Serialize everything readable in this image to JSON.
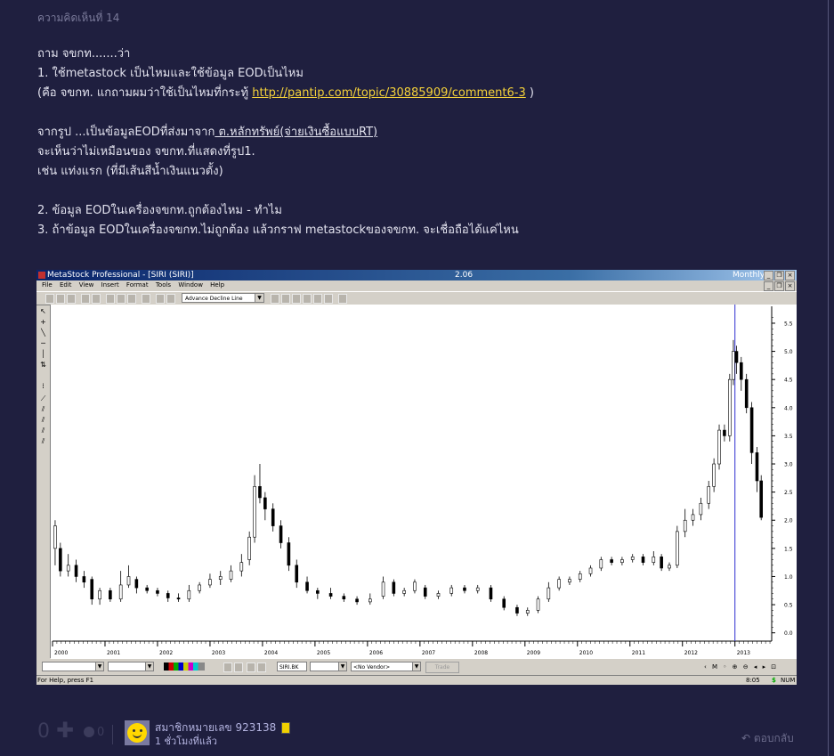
{
  "comment": {
    "number_label": "ความคิดเห็นที่ 14",
    "lines": [
      "ถาม จขกท.......ว่า",
      "1. ใช้metastock เป็นไหมและใช้ข้อมูล EODเป็นไหม",
      "(คือ จขกท. แกถามผมว่าใช้เป็นไหมที่กระทู้ ",
      "http://pantip.com/topic/30885909/comment6-3",
      " )",
      "จากรูป ...เป็นข้อมูลEODที่ส่งมาจาก",
      " ต.หลักทรัพย์(จ่ายเงินซื้อแบบRT)",
      "จะเห็นว่าไม่เหมือนของ จขกท.ที่แสดงที่รูป1.",
      "เช่น แท่งแรก (ที่มีเส้นสีน้ำเงินแนวตั้ง)",
      "2. ข้อมูล EODในเครื่องจขกท.ถูกต้องไหม - ทำไม",
      "3. ถ้าข้อมูล EODในเครื่องจขกท.ไม่ถูกต้อง แล้วกราฟ metastockของจขกท. จะเชื่อถือได้แค่ไหน"
    ]
  },
  "screenshot": {
    "title": "MetaStock Professional - [SIRI (SIRI)]",
    "version": "2.06",
    "period": "Monthly",
    "menu": [
      "File",
      "Edit",
      "View",
      "Insert",
      "Format",
      "Tools",
      "Window",
      "Help"
    ],
    "indicator_select": "Advance Decline Line",
    "symbol_box": "SIRI.BK",
    "vendor_select": "<No Vendor>",
    "trade_label": "Trade",
    "status_help": "For Help, press F1",
    "status_time": "8:05",
    "status_dollar": "$",
    "status_num": "NUM"
  },
  "chart_data": {
    "type": "candlestick",
    "title": "",
    "x_tick_labels": [
      "2000",
      "2001",
      "2002",
      "2003",
      "2004",
      "2005",
      "2006",
      "2007",
      "2008",
      "2009",
      "2010",
      "2011",
      "2012",
      "2013"
    ],
    "y_tick_labels": [
      "0.0",
      "0.5",
      "1.0",
      "1.5",
      "2.0",
      "2.5",
      "3.0",
      "3.5",
      "4.0",
      "4.5",
      "5.0",
      "5.5"
    ],
    "ylim": [
      -0.1,
      5.8
    ],
    "xlim": [
      2000.0,
      2013.7
    ],
    "grid": false,
    "line_color": "#000000",
    "marker_line": {
      "x": 2013.0,
      "color": "#3030d0"
    },
    "series": [
      {
        "values": [
          {
            "x": 2000.05,
            "o": 1.5,
            "c": 1.9,
            "h": 2.0,
            "l": 1.2
          },
          {
            "x": 2000.15,
            "o": 1.5,
            "c": 1.1,
            "h": 1.6,
            "l": 1.0
          },
          {
            "x": 2000.3,
            "o": 1.1,
            "c": 1.2,
            "h": 1.4,
            "l": 1.0
          },
          {
            "x": 2000.45,
            "o": 1.2,
            "c": 1.0,
            "h": 1.3,
            "l": 0.9
          },
          {
            "x": 2000.6,
            "o": 1.0,
            "c": 0.9,
            "h": 1.1,
            "l": 0.8
          },
          {
            "x": 2000.75,
            "o": 0.95,
            "c": 0.6,
            "h": 1.0,
            "l": 0.5
          },
          {
            "x": 2000.9,
            "o": 0.6,
            "c": 0.75,
            "h": 0.8,
            "l": 0.5
          },
          {
            "x": 2001.1,
            "o": 0.75,
            "c": 0.6,
            "h": 0.8,
            "l": 0.55
          },
          {
            "x": 2001.3,
            "o": 0.6,
            "c": 0.85,
            "h": 1.1,
            "l": 0.55
          },
          {
            "x": 2001.45,
            "o": 0.85,
            "c": 1.0,
            "h": 1.2,
            "l": 0.8
          },
          {
            "x": 2001.6,
            "o": 0.95,
            "c": 0.8,
            "h": 1.0,
            "l": 0.7
          },
          {
            "x": 2001.8,
            "o": 0.8,
            "c": 0.75,
            "h": 0.85,
            "l": 0.7
          },
          {
            "x": 2002.0,
            "o": 0.75,
            "c": 0.7,
            "h": 0.8,
            "l": 0.65
          },
          {
            "x": 2002.2,
            "o": 0.7,
            "c": 0.62,
            "h": 0.75,
            "l": 0.55
          },
          {
            "x": 2002.4,
            "o": 0.62,
            "c": 0.6,
            "h": 0.7,
            "l": 0.55
          },
          {
            "x": 2002.6,
            "o": 0.6,
            "c": 0.75,
            "h": 0.85,
            "l": 0.55
          },
          {
            "x": 2002.8,
            "o": 0.75,
            "c": 0.85,
            "h": 0.9,
            "l": 0.7
          },
          {
            "x": 2003.0,
            "o": 0.85,
            "c": 0.95,
            "h": 1.05,
            "l": 0.8
          },
          {
            "x": 2003.2,
            "o": 0.95,
            "c": 1.0,
            "h": 1.1,
            "l": 0.85
          },
          {
            "x": 2003.4,
            "o": 0.95,
            "c": 1.1,
            "h": 1.2,
            "l": 0.9
          },
          {
            "x": 2003.6,
            "o": 1.1,
            "c": 1.25,
            "h": 1.4,
            "l": 1.0
          },
          {
            "x": 2003.75,
            "o": 1.3,
            "c": 1.7,
            "h": 1.8,
            "l": 1.2
          },
          {
            "x": 2003.85,
            "o": 1.7,
            "c": 2.6,
            "h": 2.8,
            "l": 1.6
          },
          {
            "x": 2003.95,
            "o": 2.6,
            "c": 2.4,
            "h": 3.0,
            "l": 2.3
          },
          {
            "x": 2004.05,
            "o": 2.4,
            "c": 2.2,
            "h": 2.5,
            "l": 2.0
          },
          {
            "x": 2004.2,
            "o": 2.2,
            "c": 1.9,
            "h": 2.3,
            "l": 1.8
          },
          {
            "x": 2004.35,
            "o": 1.9,
            "c": 1.6,
            "h": 2.0,
            "l": 1.5
          },
          {
            "x": 2004.5,
            "o": 1.6,
            "c": 1.2,
            "h": 1.7,
            "l": 1.1
          },
          {
            "x": 2004.65,
            "o": 1.2,
            "c": 0.9,
            "h": 1.3,
            "l": 0.8
          },
          {
            "x": 2004.85,
            "o": 0.9,
            "c": 0.75,
            "h": 1.0,
            "l": 0.7
          },
          {
            "x": 2005.05,
            "o": 0.75,
            "c": 0.7,
            "h": 0.8,
            "l": 0.6
          },
          {
            "x": 2005.3,
            "o": 0.7,
            "c": 0.65,
            "h": 0.8,
            "l": 0.6
          },
          {
            "x": 2005.55,
            "o": 0.65,
            "c": 0.6,
            "h": 0.7,
            "l": 0.55
          },
          {
            "x": 2005.8,
            "o": 0.6,
            "c": 0.55,
            "h": 0.65,
            "l": 0.5
          },
          {
            "x": 2006.05,
            "o": 0.55,
            "c": 0.6,
            "h": 0.7,
            "l": 0.5
          },
          {
            "x": 2006.3,
            "o": 0.65,
            "c": 0.9,
            "h": 1.0,
            "l": 0.6
          },
          {
            "x": 2006.5,
            "o": 0.9,
            "c": 0.7,
            "h": 0.95,
            "l": 0.65
          },
          {
            "x": 2006.7,
            "o": 0.7,
            "c": 0.75,
            "h": 0.8,
            "l": 0.65
          },
          {
            "x": 2006.9,
            "o": 0.75,
            "c": 0.9,
            "h": 0.95,
            "l": 0.7
          },
          {
            "x": 2007.1,
            "o": 0.8,
            "c": 0.65,
            "h": 0.85,
            "l": 0.6
          },
          {
            "x": 2007.35,
            "o": 0.65,
            "c": 0.7,
            "h": 0.75,
            "l": 0.6
          },
          {
            "x": 2007.6,
            "o": 0.7,
            "c": 0.8,
            "h": 0.85,
            "l": 0.65
          },
          {
            "x": 2007.85,
            "o": 0.8,
            "c": 0.75,
            "h": 0.85,
            "l": 0.7
          },
          {
            "x": 2008.1,
            "o": 0.75,
            "c": 0.8,
            "h": 0.85,
            "l": 0.7
          },
          {
            "x": 2008.35,
            "o": 0.8,
            "c": 0.6,
            "h": 0.85,
            "l": 0.55
          },
          {
            "x": 2008.6,
            "o": 0.6,
            "c": 0.45,
            "h": 0.65,
            "l": 0.4
          },
          {
            "x": 2008.85,
            "o": 0.45,
            "c": 0.35,
            "h": 0.5,
            "l": 0.3
          },
          {
            "x": 2009.05,
            "o": 0.35,
            "c": 0.4,
            "h": 0.45,
            "l": 0.3
          },
          {
            "x": 2009.25,
            "o": 0.4,
            "c": 0.6,
            "h": 0.65,
            "l": 0.35
          },
          {
            "x": 2009.45,
            "o": 0.6,
            "c": 0.8,
            "h": 0.9,
            "l": 0.55
          },
          {
            "x": 2009.65,
            "o": 0.8,
            "c": 0.95,
            "h": 1.0,
            "l": 0.75
          },
          {
            "x": 2009.85,
            "o": 0.9,
            "c": 0.95,
            "h": 1.0,
            "l": 0.85
          },
          {
            "x": 2010.05,
            "o": 0.95,
            "c": 1.05,
            "h": 1.1,
            "l": 0.9
          },
          {
            "x": 2010.25,
            "o": 1.05,
            "c": 1.15,
            "h": 1.2,
            "l": 1.0
          },
          {
            "x": 2010.45,
            "o": 1.15,
            "c": 1.3,
            "h": 1.35,
            "l": 1.1
          },
          {
            "x": 2010.65,
            "o": 1.3,
            "c": 1.25,
            "h": 1.35,
            "l": 1.2
          },
          {
            "x": 2010.85,
            "o": 1.25,
            "c": 1.3,
            "h": 1.35,
            "l": 1.2
          },
          {
            "x": 2011.05,
            "o": 1.3,
            "c": 1.35,
            "h": 1.4,
            "l": 1.25
          },
          {
            "x": 2011.25,
            "o": 1.35,
            "c": 1.25,
            "h": 1.4,
            "l": 1.2
          },
          {
            "x": 2011.45,
            "o": 1.25,
            "c": 1.35,
            "h": 1.45,
            "l": 1.2
          },
          {
            "x": 2011.6,
            "o": 1.35,
            "c": 1.15,
            "h": 1.4,
            "l": 1.1
          },
          {
            "x": 2011.75,
            "o": 1.15,
            "c": 1.2,
            "h": 1.25,
            "l": 1.1
          },
          {
            "x": 2011.9,
            "o": 1.2,
            "c": 1.8,
            "h": 1.9,
            "l": 1.15
          },
          {
            "x": 2012.05,
            "o": 1.8,
            "c": 2.0,
            "h": 2.2,
            "l": 1.7
          },
          {
            "x": 2012.2,
            "o": 2.0,
            "c": 2.1,
            "h": 2.2,
            "l": 1.9
          },
          {
            "x": 2012.35,
            "o": 2.1,
            "c": 2.3,
            "h": 2.4,
            "l": 2.0
          },
          {
            "x": 2012.5,
            "o": 2.3,
            "c": 2.6,
            "h": 2.7,
            "l": 2.2
          },
          {
            "x": 2012.6,
            "o": 2.6,
            "c": 3.0,
            "h": 3.1,
            "l": 2.5
          },
          {
            "x": 2012.7,
            "o": 3.0,
            "c": 3.6,
            "h": 3.7,
            "l": 2.9
          },
          {
            "x": 2012.8,
            "o": 3.6,
            "c": 3.5,
            "h": 3.7,
            "l": 3.4
          },
          {
            "x": 2012.9,
            "o": 3.5,
            "c": 4.5,
            "h": 4.6,
            "l": 3.4
          },
          {
            "x": 2012.97,
            "o": 4.5,
            "c": 5.0,
            "h": 5.2,
            "l": 4.4
          },
          {
            "x": 2013.03,
            "o": 5.0,
            "c": 4.8,
            "h": 5.1,
            "l": 4.6
          },
          {
            "x": 2013.12,
            "o": 4.8,
            "c": 4.5,
            "h": 4.9,
            "l": 4.3
          },
          {
            "x": 2013.22,
            "o": 4.5,
            "c": 4.0,
            "h": 4.6,
            "l": 3.9
          },
          {
            "x": 2013.32,
            "o": 4.0,
            "c": 3.2,
            "h": 4.1,
            "l": 3.0
          },
          {
            "x": 2013.42,
            "o": 3.2,
            "c": 2.7,
            "h": 3.3,
            "l": 2.5
          },
          {
            "x": 2013.5,
            "o": 2.7,
            "c": 2.05,
            "h": 2.8,
            "l": 2.0
          }
        ]
      }
    ]
  },
  "footer": {
    "votes": "0",
    "emotion_count": "0",
    "member": "สมาชิกหมายเลข 923138",
    "time_ago": "1 ชั่วโมงที่แล้ว",
    "reply": "ตอบกลับ"
  }
}
